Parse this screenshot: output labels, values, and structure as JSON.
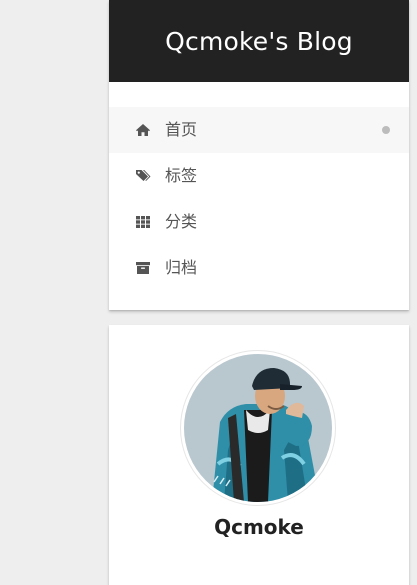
{
  "site": {
    "title": "Qcmoke's Blog"
  },
  "menu": {
    "items": [
      {
        "label": "首页",
        "icon": "home-icon",
        "active": true
      },
      {
        "label": "标签",
        "icon": "tags-icon",
        "active": false
      },
      {
        "label": "分类",
        "icon": "th-icon",
        "active": false
      },
      {
        "label": "归档",
        "icon": "archive-icon",
        "active": false
      }
    ]
  },
  "author": {
    "name": "Qcmoke",
    "avatar": "avatar-illustration"
  },
  "colors": {
    "header_bg": "#222222",
    "page_bg": "#eeeeee",
    "menu_text": "#555555",
    "avatar_jacket": "#2f8fa8"
  }
}
